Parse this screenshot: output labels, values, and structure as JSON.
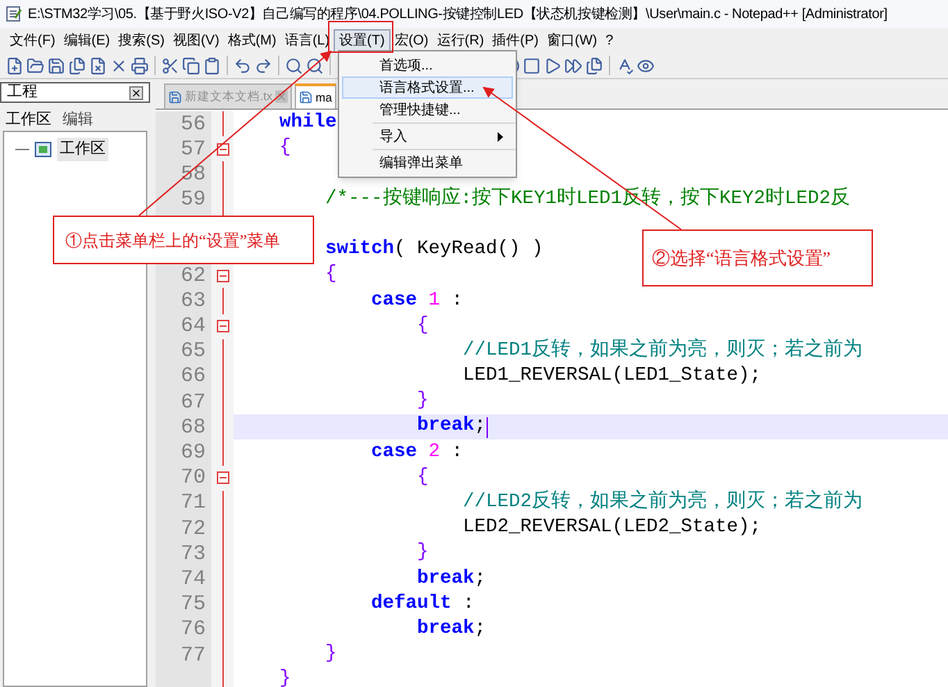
{
  "window": {
    "title": "E:\\STM32学习\\05.【基于野火ISO-V2】自己编写的程序\\04.POLLING-按键控制LED【状态机按键检测】\\User\\main.c - Notepad++ [Administrator]"
  },
  "menu_bar": [
    {
      "label": "文件(F)",
      "selected": false
    },
    {
      "label": "编辑(E)",
      "selected": false
    },
    {
      "label": "搜索(S)",
      "selected": false
    },
    {
      "label": "视图(V)",
      "selected": false
    },
    {
      "label": "格式(M)",
      "selected": false
    },
    {
      "label": "语言(L)",
      "selected": false
    },
    {
      "label": "设置(T)",
      "selected": true
    },
    {
      "label": "宏(O)",
      "selected": false
    },
    {
      "label": "运行(R)",
      "selected": false
    },
    {
      "label": "插件(P)",
      "selected": false
    },
    {
      "label": "窗口(W)",
      "selected": false
    },
    {
      "label": "?",
      "selected": false
    }
  ],
  "dropdown": [
    {
      "kind": "item",
      "label": "首选项...",
      "selected": false,
      "submenu": false
    },
    {
      "kind": "item",
      "label": "语言格式设置...",
      "selected": true,
      "submenu": false
    },
    {
      "kind": "item",
      "label": "管理快捷键...",
      "selected": false,
      "submenu": false
    },
    {
      "kind": "separator"
    },
    {
      "kind": "item",
      "label": "导入",
      "selected": false,
      "submenu": true
    },
    {
      "kind": "separator"
    },
    {
      "kind": "item",
      "label": "编辑弹出菜单",
      "selected": false,
      "submenu": false
    }
  ],
  "project_panel": {
    "title": "工程",
    "tabs": [
      {
        "label": "工作区",
        "selected": true
      },
      {
        "label": "编辑",
        "selected": false
      }
    ],
    "tree": [
      {
        "label": "工作区"
      }
    ]
  },
  "editor_tabs": [
    {
      "label": "新建文本文档.tx",
      "selected": false
    },
    {
      "label": "ma",
      "selected": true
    }
  ],
  "code_lines": [
    {
      "number": "56",
      "fold": false,
      "highlighted": false,
      "tokens": [
        {
          "kind": "keyword",
          "text": "    while"
        }
      ]
    },
    {
      "number": "57",
      "fold": true,
      "highlighted": false,
      "tokens": [
        {
          "kind": "brace",
          "text": "    {"
        }
      ]
    },
    {
      "number": "58",
      "fold": false,
      "highlighted": false
    },
    {
      "number": "59",
      "fold": false,
      "highlighted": false,
      "tokens": [
        {
          "kind": "comment_block",
          "text": "        /*---按键响应:按下KEY1时LED1反转，按下KEY2时LED2反"
        }
      ]
    },
    {
      "highlighted": false
    },
    {
      "highlighted": false,
      "tokens": [
        {
          "kind": "keyword",
          "text": "        switch"
        },
        {
          "kind": "plain",
          "text": "( KeyRead() )"
        }
      ]
    },
    {
      "number": "62",
      "fold": true,
      "highlighted": false,
      "tokens": [
        {
          "kind": "brace",
          "text": "        {"
        }
      ]
    },
    {
      "number": "63",
      "fold": false,
      "highlighted": false,
      "tokens": [
        {
          "kind": "keyword",
          "text": "            case "
        },
        {
          "kind": "number",
          "text": "1"
        },
        {
          "kind": "plain",
          "text": " :"
        }
      ]
    },
    {
      "number": "64",
      "fold": true,
      "highlighted": false,
      "tokens": [
        {
          "kind": "brace",
          "text": "                {"
        }
      ]
    },
    {
      "number": "65",
      "fold": false,
      "highlighted": false,
      "tokens": [
        {
          "kind": "comment_line",
          "text": "                    //LED1反转，如果之前为亮，则灭；若之前为"
        }
      ]
    },
    {
      "number": "66",
      "fold": false,
      "highlighted": false,
      "tokens": [
        {
          "kind": "plain",
          "text": "                    LED1_REVERSAL(LED1_State);"
        }
      ]
    },
    {
      "number": "67",
      "fold": false,
      "highlighted": false,
      "tokens": [
        {
          "kind": "brace",
          "text": "                }"
        }
      ]
    },
    {
      "number": "68",
      "fold": false,
      "highlighted": true,
      "tokens": [
        {
          "kind": "keyword",
          "text": "                break"
        },
        {
          "kind": "plain",
          "text": ";"
        }
      ]
    },
    {
      "number": "69",
      "fold": false,
      "highlighted": false,
      "tokens": [
        {
          "kind": "keyword",
          "text": "            case "
        },
        {
          "kind": "number",
          "text": "2"
        },
        {
          "kind": "plain",
          "text": " :"
        }
      ]
    },
    {
      "number": "70",
      "fold": true,
      "highlighted": false,
      "tokens": [
        {
          "kind": "brace",
          "text": "                {"
        }
      ]
    },
    {
      "number": "71",
      "fold": false,
      "highlighted": false,
      "tokens": [
        {
          "kind": "comment_line",
          "text": "                    //LED2反转，如果之前为亮，则灭；若之前为"
        }
      ]
    },
    {
      "number": "72",
      "fold": false,
      "highlighted": false,
      "tokens": [
        {
          "kind": "plain",
          "text": "                    LED2_REVERSAL(LED2_State);"
        }
      ]
    },
    {
      "number": "73",
      "fold": false,
      "highlighted": false,
      "tokens": [
        {
          "kind": "brace",
          "text": "                }"
        }
      ]
    },
    {
      "number": "74",
      "fold": false,
      "highlighted": false,
      "tokens": [
        {
          "kind": "keyword",
          "text": "                break"
        },
        {
          "kind": "plain",
          "text": ";"
        }
      ]
    },
    {
      "number": "75",
      "fold": false,
      "highlighted": false,
      "tokens": [
        {
          "kind": "keyword",
          "text": "            default"
        },
        {
          "kind": "plain",
          "text": " :"
        }
      ]
    },
    {
      "number": "76",
      "fold": false,
      "highlighted": false,
      "tokens": [
        {
          "kind": "keyword",
          "text": "                break"
        },
        {
          "kind": "plain",
          "text": ";"
        }
      ]
    },
    {
      "number": "77",
      "fold": false,
      "highlighted": false,
      "tokens": [
        {
          "kind": "brace",
          "text": "        }"
        }
      ]
    },
    {
      "fold": false,
      "highlighted": false,
      "tokens": [
        {
          "kind": "brace",
          "text": "    }"
        }
      ]
    }
  ],
  "annotations": [
    {
      "text": "①点击菜单栏上的“设置”菜单"
    },
    {
      "text": "②选择“语言格式设置”"
    }
  ]
}
